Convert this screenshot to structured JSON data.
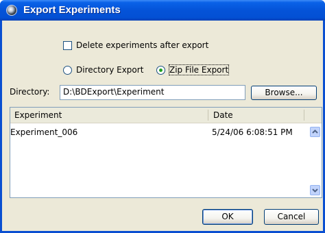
{
  "window": {
    "title": "Export Experiments"
  },
  "options": {
    "delete_after_export_label": "Delete experiments after export",
    "delete_after_export_checked": false,
    "export_type": {
      "directory_label": "Directory Export",
      "zip_label": "Zip File Export",
      "selected": "zip"
    }
  },
  "directory": {
    "label": "Directory:",
    "value": "D:\\BDExport\\Experiment",
    "browse_label": "Browse..."
  },
  "table": {
    "columns": [
      "Experiment",
      "Date"
    ],
    "rows": [
      {
        "experiment": "Experiment_006",
        "date": "5/24/06 6:08:51 PM"
      }
    ]
  },
  "buttons": {
    "ok_label": "OK",
    "cancel_label": "Cancel"
  },
  "icons": {
    "title_icon": "app-globe-icon",
    "scroll_up": "chevron-up-icon",
    "scroll_down": "chevron-down-icon"
  },
  "colors": {
    "titlebar_blue": "#0453d8",
    "dialog_bg": "#ece9d8",
    "radio_selected": "#21a121"
  }
}
